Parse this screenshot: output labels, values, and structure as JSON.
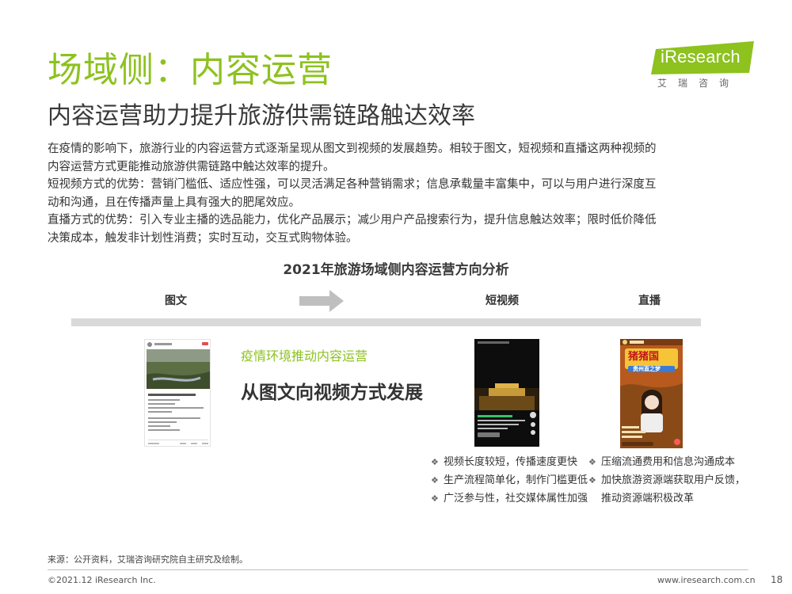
{
  "header": {
    "title": "场域侧：内容运营",
    "subtitle": "内容运营助力提升旅游供需链路触达效率"
  },
  "logo": {
    "name": "iResearch",
    "sub": "艾瑞咨询",
    "brand_color": "#8dc21f"
  },
  "intro": [
    "在疫情的影响下，旅游行业的内容运营方式逐渐呈现从图文到视频的发展趋势。相较于图文，短视频和直播这两种视频的",
    "内容运营方式更能推动旅游供需链路中触达效率的提升。",
    "短视频方式的优势：营销门槛低、适应性强，可以灵活满足各种营销需求；信息承载量丰富集中，可以与用户进行深度互",
    "动和沟通，且在传播声量上具有强大的肥尾效应。",
    "直播方式的优势：引入专业主播的选品能力，优化产品展示；减少用户产品搜索行为，提升信息触达效率；限时低价降低",
    "决策成本，触发非计划性消费；实时互动，交互式购物体验。"
  ],
  "diagram": {
    "title": "2021年旅游场域侧内容运营方向分析",
    "stages": {
      "text": "图文",
      "short_video": "短视频",
      "live": "直播"
    },
    "green_caption": "疫情环境推动内容运营",
    "big_caption": "从图文向视频方式发展",
    "bullets_left": [
      "视频长度较短，传播速度更快",
      "生产流程简单化，制作门槛更低",
      "广泛参与性，社交媒体属性加强"
    ],
    "bullets_right": [
      "压缩流通费用和信息沟通成本",
      "加快旅游资源端获取用户反馈，",
      "推动资源端积极改革"
    ],
    "live_banner": "猪猪国",
    "live_banner_sub": "贵州直之梦"
  },
  "footer": {
    "source": "来源：公开资料，艾瑞咨询研究院自主研究及绘制。",
    "copyright": "©2021.12 iResearch Inc.",
    "site": "www.iresearch.com.cn",
    "page": "18"
  }
}
